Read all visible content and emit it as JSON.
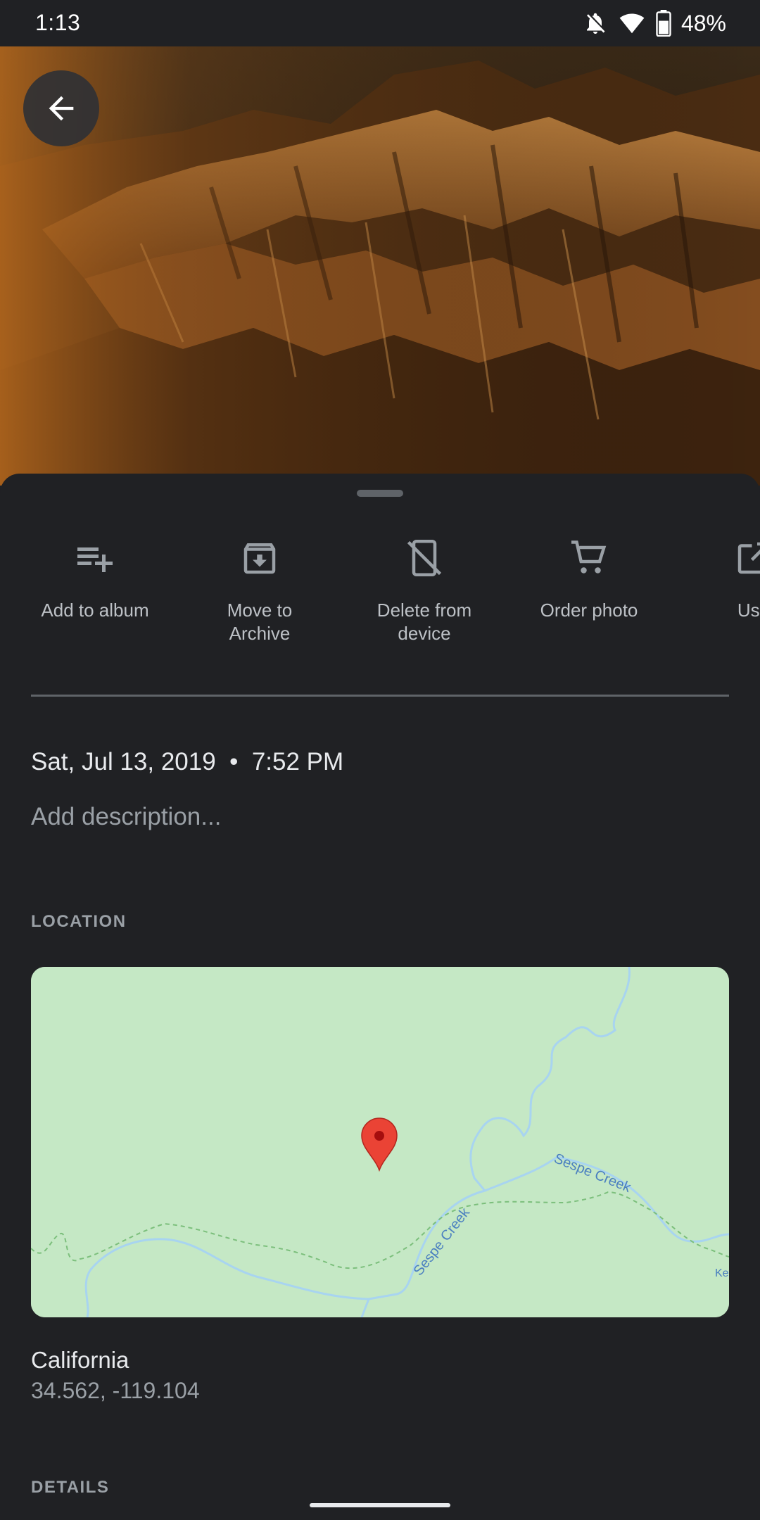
{
  "status_bar": {
    "time": "1:13",
    "battery_percent": "48%",
    "icons": [
      "notifications-off-icon",
      "wifi-icon",
      "battery-icon"
    ]
  },
  "photo": {
    "subject": "aerial mountain ridges at sunset",
    "back_icon": "arrow-back-icon"
  },
  "actions": [
    {
      "label": "Add to album",
      "icon": "playlist-add-icon"
    },
    {
      "label": "Move to\nArchive",
      "icon": "archive-icon"
    },
    {
      "label": "Delete from\ndevice",
      "icon": "phone-off-icon"
    },
    {
      "label": "Order photo",
      "icon": "cart-icon"
    },
    {
      "label": "Use",
      "icon": "open-in-new-icon"
    }
  ],
  "info": {
    "datetime": "Sat, Jul 13, 2019  •  7:52 PM",
    "description_placeholder": "Add description..."
  },
  "location": {
    "section_label": "LOCATION",
    "map_labels": [
      "Sespe Creek",
      "Sespe Creek",
      "Ke"
    ],
    "place_name": "California",
    "coordinates": "34.562, -119.104"
  },
  "details": {
    "section_label": "DETAILS"
  },
  "colors": {
    "background": "#202124",
    "map_land": "#c5e8c5",
    "map_water": "#a8d4f0",
    "map_label": "#4a7fc0",
    "pin": "#ea4335"
  }
}
